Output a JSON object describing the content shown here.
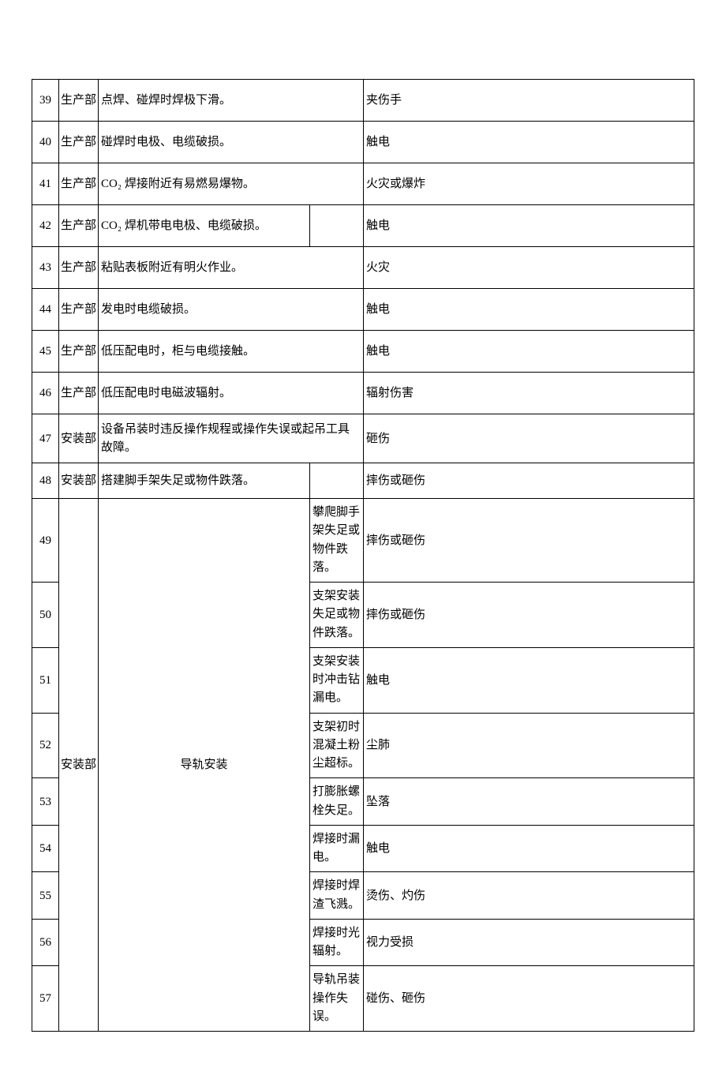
{
  "rows_top": [
    {
      "n": "39",
      "dept": "生产部",
      "task": "点焊、碰焊时焊极下滑。",
      "sub": "",
      "res": "夹伤手"
    },
    {
      "n": "40",
      "dept": "生产部",
      "task": "碰焊时电极、电缆破损。",
      "sub": "",
      "res": "触电"
    },
    {
      "n": "41",
      "dept": "生产部",
      "task": "CO₂ 焊接附近有易燃易爆物。",
      "sub": "",
      "res": "火灾或爆炸"
    },
    {
      "n": "42",
      "dept": "生产部",
      "task": "CO₂ 焊机带电电极、电缆破损。",
      "sub": "",
      "res": "触电"
    },
    {
      "n": "43",
      "dept": "生产部",
      "task": "粘贴表板附近有明火作业。",
      "sub": "",
      "res": "火灾"
    },
    {
      "n": "44",
      "dept": "生产部",
      "task": "发电时电缆破损。",
      "sub": "",
      "res": "触电"
    },
    {
      "n": "45",
      "dept": "生产部",
      "task": "低压配电时，柜与电缆接触。",
      "sub": "",
      "res": "触电"
    },
    {
      "n": "46",
      "dept": "生产部",
      "task": "低压配电时电磁波辐射。",
      "sub": "",
      "res": "辐射伤害"
    }
  ],
  "row47": {
    "n": "47",
    "dept": "安装部",
    "task": "设备吊装时违反操作规程或操作失误或起吊工具故障。",
    "sub": "",
    "res": "砸伤"
  },
  "row48": {
    "n": "48",
    "dept": "安装部",
    "task": "搭建脚手架失足或物件跌落。",
    "sub": "",
    "res": "摔伤或砸伤"
  },
  "group": {
    "dept": "安装部",
    "task": "导轨安装",
    "items": [
      {
        "n": "49",
        "sub": "攀爬脚手架失足或物件跌落。",
        "res": "摔伤或砸伤"
      },
      {
        "n": "50",
        "sub": "支架安装失足或物件跌落。",
        "res": "摔伤或砸伤"
      },
      {
        "n": "51",
        "sub": "支架安装时冲击钻漏电。",
        "res": "触电"
      },
      {
        "n": "52",
        "sub": "支架初时混凝土粉尘超标。",
        "res": "尘肺"
      },
      {
        "n": "53",
        "sub": "打膨胀螺栓失足。",
        "res": "坠落"
      },
      {
        "n": "54",
        "sub": "焊接时漏电。",
        "res": "触电"
      },
      {
        "n": "55",
        "sub": "焊接时焊渣飞溅。",
        "res": "烫伤、灼伤"
      },
      {
        "n": "56",
        "sub": "焊接时光辐射。",
        "res": "视力受损"
      },
      {
        "n": "57",
        "sub": "导轨吊装操作失误。",
        "res": "碰伤、砸伤"
      }
    ]
  }
}
